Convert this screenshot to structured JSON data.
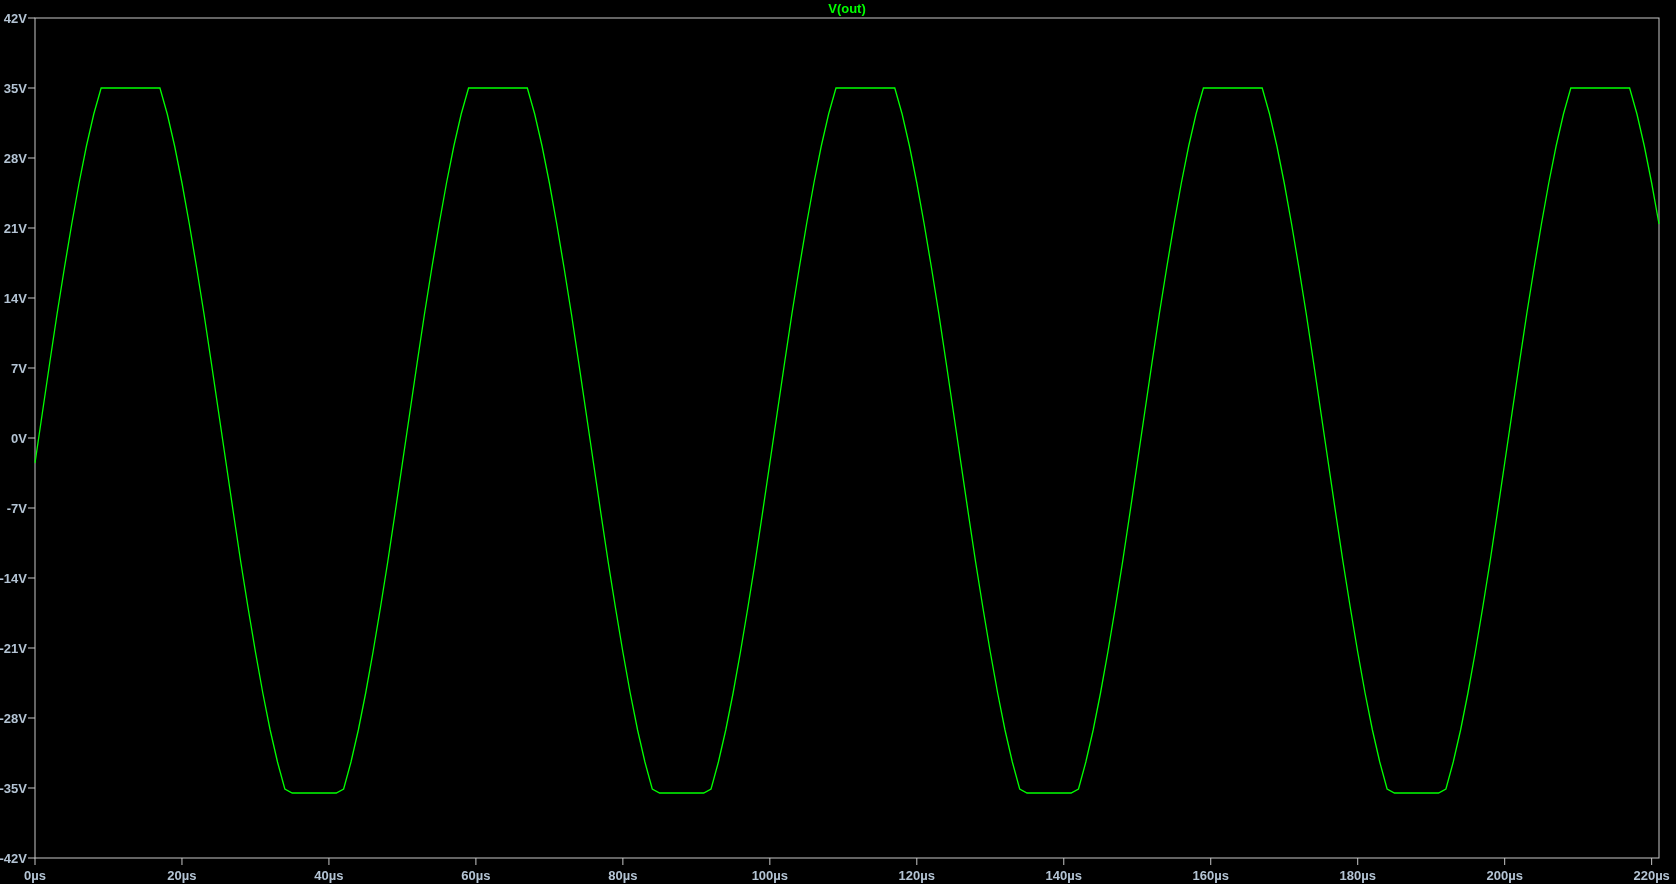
{
  "plot": {
    "chart_data": {
      "type": "line",
      "x": [
        0,
        1,
        2,
        3,
        4,
        5,
        6,
        7,
        8,
        9,
        10,
        11,
        12,
        13,
        14,
        15,
        16,
        17,
        18,
        19,
        20,
        21,
        22,
        23,
        24,
        25,
        26,
        27,
        28,
        29,
        30,
        31,
        32,
        33,
        34,
        35,
        36,
        37,
        38,
        39,
        40,
        41,
        42,
        43,
        44,
        45,
        46,
        47,
        48,
        49,
        50,
        51,
        52,
        53,
        54,
        55,
        56,
        57,
        58,
        59,
        60,
        61,
        62,
        63,
        64,
        65,
        66,
        67,
        68,
        69,
        70,
        71,
        72,
        73,
        74,
        75,
        76,
        77,
        78,
        79,
        80,
        81,
        82,
        83,
        84,
        85,
        86,
        87,
        88,
        89,
        90,
        91,
        92,
        93,
        94,
        95,
        96,
        97,
        98,
        99,
        100,
        101,
        102,
        103,
        104,
        105,
        106,
        107,
        108,
        109,
        110,
        111,
        112,
        113,
        114,
        115,
        116,
        117,
        118,
        119,
        120,
        121,
        122,
        123,
        124,
        125,
        126,
        127,
        128,
        129,
        130,
        131,
        132,
        133,
        134,
        135,
        136,
        137,
        138,
        139,
        140,
        141,
        142,
        143,
        144,
        145,
        146,
        147,
        148,
        149,
        150,
        151,
        152,
        153,
        154,
        155,
        156,
        157,
        158,
        159,
        160,
        161,
        162,
        163,
        164,
        165,
        166,
        167,
        168,
        169,
        170,
        171,
        172,
        173,
        174,
        175,
        176,
        177,
        178,
        179,
        180,
        181,
        182,
        183,
        184,
        185,
        186,
        187,
        188,
        189,
        190,
        191,
        192,
        193,
        194,
        195,
        196,
        197,
        198,
        199,
        200,
        201,
        202,
        203,
        204,
        205,
        206,
        207,
        208,
        209,
        210,
        211,
        212,
        213,
        214,
        215,
        216,
        217,
        218,
        219,
        220,
        221
      ],
      "series": [
        {
          "name": "V(out)",
          "color": "#00ff00",
          "values": [
            -2.5,
            2.5,
            7.5,
            12.4,
            17,
            21.4,
            25.5,
            29.2,
            32.4,
            35,
            35,
            35,
            35,
            35,
            35,
            35,
            35,
            35,
            32.4,
            29.2,
            25.5,
            21.4,
            17,
            12.4,
            7.5,
            2.5,
            -2.5,
            -7.5,
            -12.4,
            -17,
            -21.4,
            -25.5,
            -29.2,
            -32.4,
            -35.1,
            -35.5,
            -35.5,
            -35.5,
            -35.5,
            -35.5,
            -35.5,
            -35.5,
            -35.1,
            -32.4,
            -29.2,
            -25.5,
            -21.4,
            -17,
            -12.4,
            -7.5,
            -2.5,
            2.5,
            7.5,
            12.4,
            17,
            21.4,
            25.5,
            29.2,
            32.4,
            35,
            35,
            35,
            35,
            35,
            35,
            35,
            35,
            35,
            32.4,
            29.2,
            25.5,
            21.4,
            17,
            12.4,
            7.5,
            2.5,
            -2.5,
            -7.5,
            -12.4,
            -17,
            -21.4,
            -25.5,
            -29.2,
            -32.4,
            -35.1,
            -35.5,
            -35.5,
            -35.5,
            -35.5,
            -35.5,
            -35.5,
            -35.5,
            -35.1,
            -32.4,
            -29.2,
            -25.5,
            -21.4,
            -17,
            -12.4,
            -7.5,
            -2.5,
            2.5,
            7.5,
            12.4,
            17,
            21.4,
            25.5,
            29.2,
            32.4,
            35,
            35,
            35,
            35,
            35,
            35,
            35,
            35,
            35,
            32.4,
            29.2,
            25.5,
            21.4,
            17,
            12.4,
            7.5,
            2.5,
            -2.5,
            -7.5,
            -12.4,
            -17,
            -21.4,
            -25.5,
            -29.2,
            -32.4,
            -35.1,
            -35.5,
            -35.5,
            -35.5,
            -35.5,
            -35.5,
            -35.5,
            -35.5,
            -35.1,
            -32.4,
            -29.2,
            -25.5,
            -21.4,
            -17,
            -12.4,
            -7.5,
            -2.5,
            2.5,
            7.5,
            12.4,
            17,
            21.4,
            25.5,
            29.2,
            32.4,
            35,
            35,
            35,
            35,
            35,
            35,
            35,
            35,
            35,
            32.4,
            29.2,
            25.5,
            21.4,
            17,
            12.4,
            7.5,
            2.5,
            -2.5,
            -7.5,
            -12.4,
            -17,
            -21.4,
            -25.5,
            -29.2,
            -32.4,
            -35.1,
            -35.5,
            -35.5,
            -35.5,
            -35.5,
            -35.5,
            -35.5,
            -35.5,
            -35.1,
            -32.4,
            -29.2,
            -25.5,
            -21.4,
            -17,
            -12.4,
            -7.5,
            -2.5,
            2.5,
            7.5,
            12.4,
            17,
            21.4,
            25.5,
            29.2,
            32.4,
            35,
            35,
            35,
            35,
            35,
            35,
            35,
            35,
            35,
            32.4,
            29.2,
            25.5,
            21.4
          ]
        }
      ],
      "xlim": [
        0,
        221
      ],
      "ylim": [
        -42,
        42
      ],
      "xticks": [
        {
          "value": 0,
          "label": "0µs"
        },
        {
          "value": 20,
          "label": "20µs"
        },
        {
          "value": 40,
          "label": "40µs"
        },
        {
          "value": 60,
          "label": "60µs"
        },
        {
          "value": 80,
          "label": "80µs"
        },
        {
          "value": 100,
          "label": "100µs"
        },
        {
          "value": 120,
          "label": "120µs"
        },
        {
          "value": 140,
          "label": "140µs"
        },
        {
          "value": 160,
          "label": "160µs"
        },
        {
          "value": 180,
          "label": "180µs"
        },
        {
          "value": 200,
          "label": "200µs"
        },
        {
          "value": 220,
          "label": "220µs"
        }
      ],
      "yticks": [
        {
          "value": 42,
          "label": "42V"
        },
        {
          "value": 35,
          "label": "35V"
        },
        {
          "value": 28,
          "label": "28V"
        },
        {
          "value": 21,
          "label": "21V"
        },
        {
          "value": 14,
          "label": "14V"
        },
        {
          "value": 7,
          "label": "7V"
        },
        {
          "value": 0,
          "label": "0V"
        },
        {
          "value": -7,
          "label": "-7V"
        },
        {
          "value": -14,
          "label": "-14V"
        },
        {
          "value": -21,
          "label": "-21V"
        },
        {
          "value": -28,
          "label": "-28V"
        },
        {
          "value": -35,
          "label": "-35V"
        },
        {
          "value": -42,
          "label": "-42V"
        }
      ]
    }
  }
}
